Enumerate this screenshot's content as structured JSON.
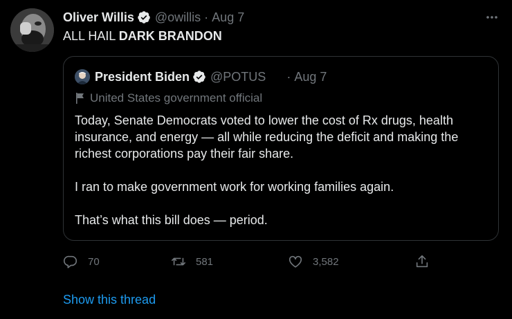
{
  "tweet": {
    "author_name": "Oliver Willis",
    "author_handle": "@owillis",
    "separator": "·",
    "date": "Aug 7",
    "text_prefix": "ALL HAIL ",
    "text_bold": "DARK BRANDON"
  },
  "quoted_tweet": {
    "author_name": "President Biden",
    "author_handle": "@POTUS",
    "separator": "·",
    "date": "Aug 7",
    "label": "United States government official",
    "paragraphs": [
      "Today, Senate Democrats voted to lower the cost of Rx drugs, health insurance, and energy — all while reducing the deficit and making the richest corporations pay their fair share.",
      "I ran to make government work for working families again.",
      "That’s what this bill does — period."
    ]
  },
  "actions": {
    "reply_count": "70",
    "retweet_count": "581",
    "like_count": "3,582"
  },
  "show_thread_label": "Show this thread",
  "colors": {
    "background": "#000000",
    "text": "#e7e9ea",
    "secondary": "#71767b",
    "accent": "#1d9bf0",
    "border": "#2f3336"
  },
  "icons": [
    "verified-badge-icon",
    "more-options-icon",
    "government-flag-icon",
    "reply-icon",
    "retweet-icon",
    "like-icon",
    "share-icon"
  ]
}
